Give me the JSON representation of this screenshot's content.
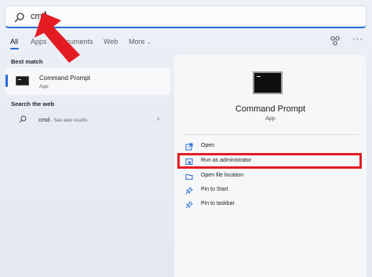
{
  "search": {
    "query": "cmd"
  },
  "tabs": [
    {
      "label": "All",
      "active": true
    },
    {
      "label": "Apps",
      "active": false
    },
    {
      "label": "Documents",
      "active": false
    },
    {
      "label": "Web",
      "active": false
    },
    {
      "label": "More",
      "active": false
    }
  ],
  "tabs_more_icon": "ellipsis-icon",
  "tabs_share_icon": "share-icon",
  "best_match": {
    "section_label": "Best match",
    "title": "Command Prompt",
    "subtitle": "App",
    "icon": "command-prompt-icon"
  },
  "web_search": {
    "section_label": "Search the web",
    "query": "cmd",
    "hint": " - See web results",
    "icon": "search-icon"
  },
  "details": {
    "title": "Command Prompt",
    "subtitle": "App",
    "actions": [
      {
        "label": "Open",
        "icon": "open-icon"
      },
      {
        "label": "Run as administrator",
        "icon": "shield-icon"
      },
      {
        "label": "Open file location",
        "icon": "folder-icon"
      },
      {
        "label": "Pin to Start",
        "icon": "pin-icon"
      },
      {
        "label": "Pin to taskbar",
        "icon": "pin-icon"
      }
    ]
  },
  "colors": {
    "accent": "#2a6bd6",
    "annotation": "#e31c24"
  }
}
